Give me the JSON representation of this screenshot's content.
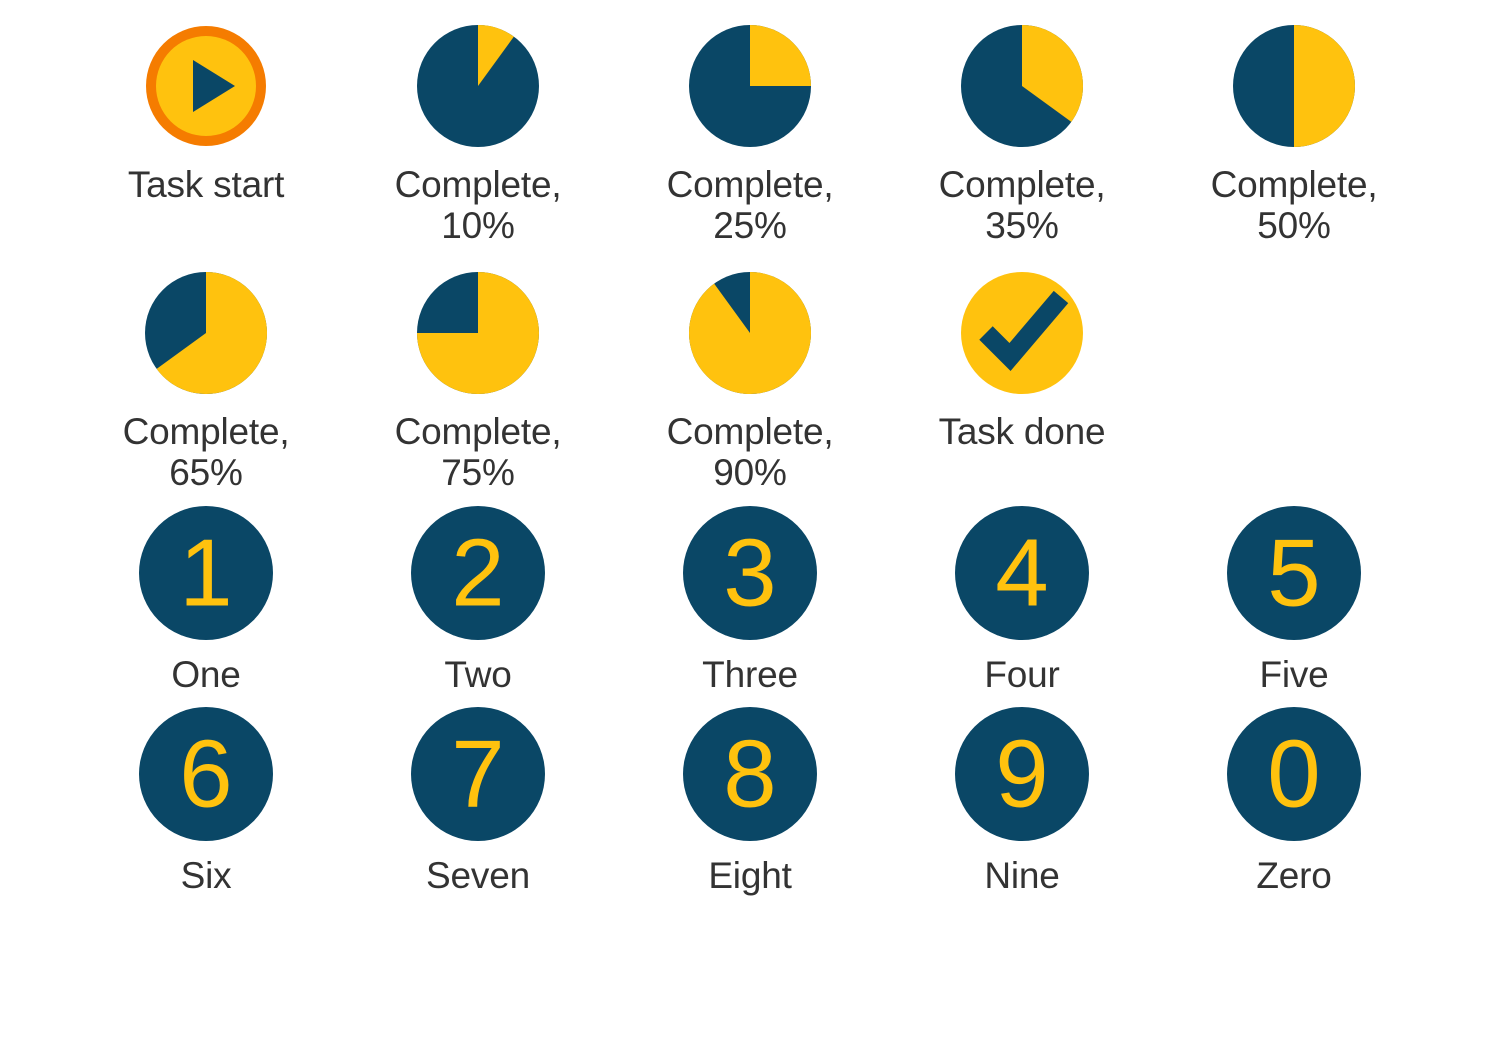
{
  "palette": {
    "navy": "#0A4766",
    "yellow": "#FFC20E",
    "orange": "#F57C00",
    "text": "#333333",
    "background": "#FFFFFF"
  },
  "rows": [
    {
      "name": "progress-row-1",
      "items": [
        {
          "kind": "play",
          "label": "Task start",
          "icon": "play-icon"
        },
        {
          "kind": "pie",
          "label": "Complete,\n10%",
          "percent": 10,
          "icon": "pie-10-icon"
        },
        {
          "kind": "pie",
          "label": "Complete,\n25%",
          "percent": 25,
          "icon": "pie-25-icon"
        },
        {
          "kind": "pie",
          "label": "Complete,\n35%",
          "percent": 35,
          "icon": "pie-35-icon"
        },
        {
          "kind": "pie",
          "label": "Complete,\n50%",
          "percent": 50,
          "icon": "pie-50-icon"
        }
      ]
    },
    {
      "name": "progress-row-2",
      "items": [
        {
          "kind": "pie",
          "label": "Complete,\n65%",
          "percent": 65,
          "icon": "pie-65-icon"
        },
        {
          "kind": "pie",
          "label": "Complete,\n75%",
          "percent": 75,
          "icon": "pie-75-icon"
        },
        {
          "kind": "pie",
          "label": "Complete,\n90%",
          "percent": 90,
          "icon": "pie-90-icon"
        },
        {
          "kind": "check",
          "label": "Task done",
          "icon": "checkmark-icon"
        },
        {
          "kind": "empty",
          "label": "",
          "icon": ""
        }
      ]
    },
    {
      "name": "digit-row-1",
      "items": [
        {
          "kind": "digit",
          "digit": "1",
          "label": "One",
          "icon": "digit-one-icon"
        },
        {
          "kind": "digit",
          "digit": "2",
          "label": "Two",
          "icon": "digit-two-icon"
        },
        {
          "kind": "digit",
          "digit": "3",
          "label": "Three",
          "icon": "digit-three-icon"
        },
        {
          "kind": "digit",
          "digit": "4",
          "label": "Four",
          "icon": "digit-four-icon"
        },
        {
          "kind": "digit",
          "digit": "5",
          "label": "Five",
          "icon": "digit-five-icon"
        }
      ]
    },
    {
      "name": "digit-row-2",
      "items": [
        {
          "kind": "digit",
          "digit": "6",
          "label": "Six",
          "icon": "digit-six-icon"
        },
        {
          "kind": "digit",
          "digit": "7",
          "label": "Seven",
          "icon": "digit-seven-icon"
        },
        {
          "kind": "digit",
          "digit": "8",
          "label": "Eight",
          "icon": "digit-eight-icon"
        },
        {
          "kind": "digit",
          "digit": "9",
          "label": "Nine",
          "icon": "digit-nine-icon"
        },
        {
          "kind": "digit",
          "digit": "0",
          "label": "Zero",
          "icon": "digit-zero-icon"
        }
      ]
    }
  ],
  "chart_data": {
    "type": "pie",
    "title": "",
    "series": [
      {
        "name": "Complete, 10%",
        "values": [
          10,
          90
        ],
        "labels": [
          "complete",
          "remaining"
        ]
      },
      {
        "name": "Complete, 25%",
        "values": [
          25,
          75
        ],
        "labels": [
          "complete",
          "remaining"
        ]
      },
      {
        "name": "Complete, 35%",
        "values": [
          35,
          65
        ],
        "labels": [
          "complete",
          "remaining"
        ]
      },
      {
        "name": "Complete, 50%",
        "values": [
          50,
          50
        ],
        "labels": [
          "complete",
          "remaining"
        ]
      },
      {
        "name": "Complete, 65%",
        "values": [
          65,
          35
        ],
        "labels": [
          "complete",
          "remaining"
        ]
      },
      {
        "name": "Complete, 75%",
        "values": [
          75,
          25
        ],
        "labels": [
          "complete",
          "remaining"
        ]
      },
      {
        "name": "Complete, 90%",
        "values": [
          90,
          10
        ],
        "labels": [
          "complete",
          "remaining"
        ]
      }
    ],
    "slice_colors": {
      "complete": "#FFC20E",
      "remaining": "#0A4766"
    },
    "start_angle_deg": 0,
    "direction": "clockwise",
    "legend": "none",
    "grid": false
  }
}
